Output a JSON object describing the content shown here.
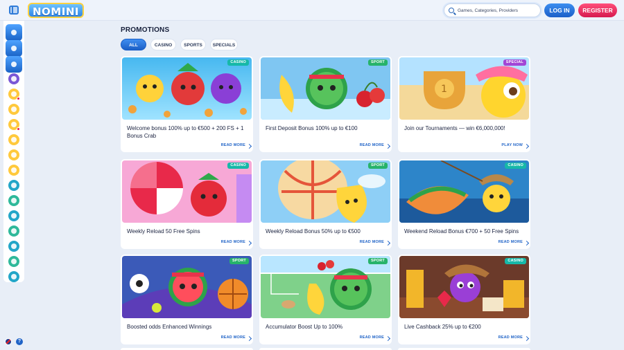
{
  "header": {
    "logo_text": "NOMINI",
    "search_placeholder": "Games, Categories, Providers",
    "login_label": "LOG IN",
    "register_label": "REGISTER"
  },
  "sidebar": {
    "items": [
      {
        "icon": "home-icon",
        "badge": false
      },
      {
        "icon": "casino-chip-icon",
        "badge": false
      },
      {
        "icon": "sports-ball-icon",
        "badge": false
      },
      {
        "icon": "dice-icon",
        "badge": false
      },
      {
        "icon": "gift-icon",
        "badge": true
      },
      {
        "icon": "lightbulb-icon",
        "badge": false
      },
      {
        "icon": "promotions-icon",
        "badge": true
      },
      {
        "icon": "trophy-icon",
        "badge": false
      },
      {
        "icon": "shop-icon",
        "badge": false
      },
      {
        "icon": "star-icon",
        "badge": false
      },
      {
        "icon": "chat-icon",
        "badge": false
      },
      {
        "icon": "cards-icon",
        "badge": false
      },
      {
        "icon": "soccer-icon",
        "badge": false
      },
      {
        "icon": "target-icon",
        "badge": false
      },
      {
        "icon": "tv-icon",
        "badge": false
      },
      {
        "icon": "chart-icon",
        "badge": false
      },
      {
        "icon": "support-icon",
        "badge": false
      }
    ],
    "colors": {
      "primary": "#1f63c7",
      "accent": "#ffc93c",
      "badge": "#e8194a"
    }
  },
  "page": {
    "title": "PROMOTIONS",
    "tabs": [
      {
        "label": "ALL",
        "active": true
      },
      {
        "label": "CASINO",
        "active": false
      },
      {
        "label": "SPORTS",
        "active": false
      },
      {
        "label": "SPECIALS",
        "active": false
      }
    ]
  },
  "promotions": [
    {
      "tag": "CASINO",
      "title": "Welcome bonus 100% up to €500 + 200 FS + 1 Bonus Crab",
      "link": "READ MORE"
    },
    {
      "tag": "SPORT",
      "title": "First Deposit Bonus 100% up to €100",
      "link": "READ MORE"
    },
    {
      "tag": "SPECIAL",
      "title": "Join our Tournaments — win €6,000,000!",
      "link": "PLAY NOW"
    },
    {
      "tag": "CASINO",
      "title": "Weekly Reload 50 Free Spins",
      "link": "READ MORE"
    },
    {
      "tag": "SPORT",
      "title": "Weekly Reload Bonus 50% up to €500",
      "link": "READ MORE"
    },
    {
      "tag": "CASINO",
      "title": "Weekend Reload Bonus €700 + 50 Free Spins",
      "link": "READ MORE"
    },
    {
      "tag": "SPORT",
      "title": "Boosted odds Enhanced Winnings",
      "link": "READ MORE"
    },
    {
      "tag": "SPORT",
      "title": "Accumulator Boost Up to 100%",
      "link": "READ MORE"
    },
    {
      "tag": "CASINO",
      "title": "Live Cashback 25% up to €200",
      "link": "READ MORE"
    }
  ],
  "tag_colors": {
    "CASINO": "#16b8a8",
    "SPORT": "#27b36a",
    "SPECIAL": "#a246d6"
  }
}
